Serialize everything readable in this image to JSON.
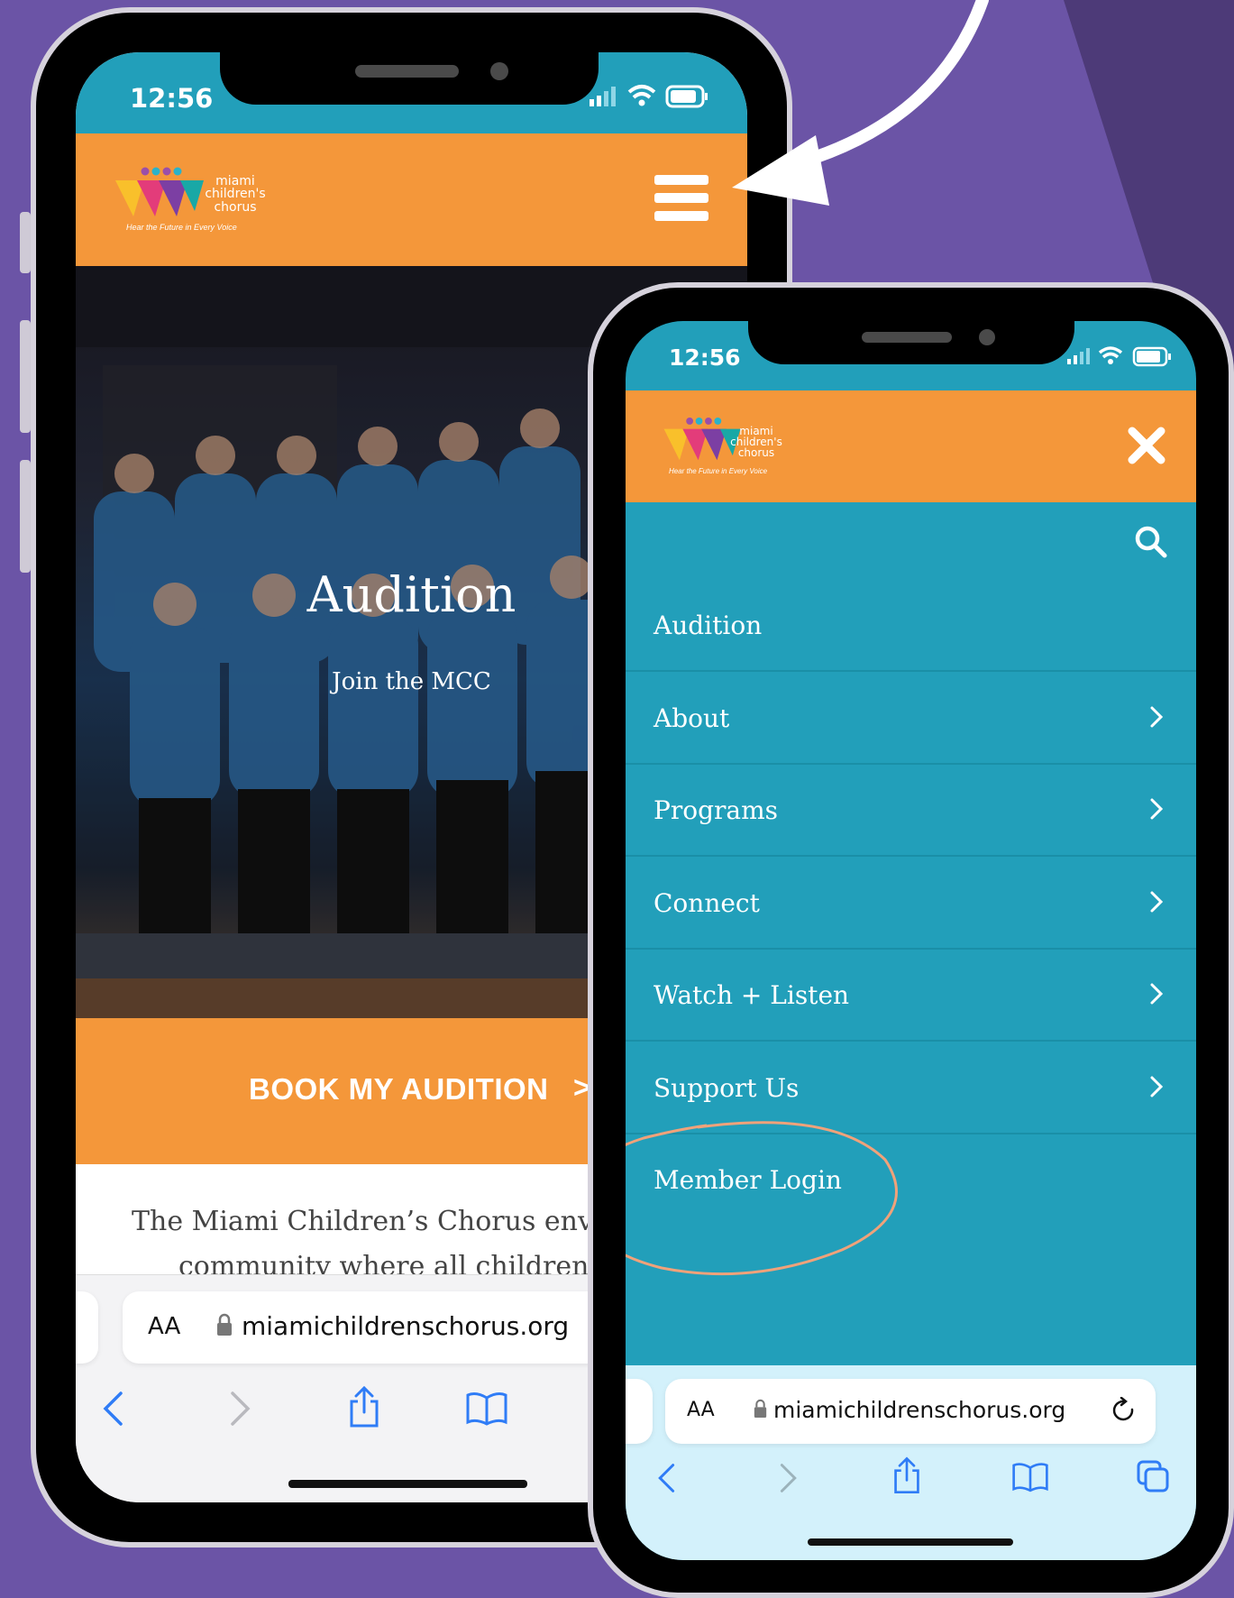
{
  "colors": {
    "background": "#6b54a6",
    "teal": "#229fba",
    "orange": "#f4973a",
    "toolbar_light": "#d3f1fb",
    "toolbar_white": "#f3f3f5",
    "accent_circle": "#f0a27a"
  },
  "logo": {
    "line1": "miami",
    "line2": "children's",
    "line3": "chorus",
    "tagline": "Hear the Future in Every Voice"
  },
  "phone_left": {
    "status_time": "12:56",
    "hero_title": "Audition",
    "hero_subtitle": "Join the MCC",
    "cta_label": "BOOK MY AUDITION",
    "cta_arrow": ">",
    "body_line1": "The Miami Children’s Chorus env",
    "body_line2": "community where all children",
    "url_aa": "AA",
    "url": "miamichildrenschorus.org",
    "toolbar_icons": [
      "back-icon",
      "forward-icon",
      "share-icon",
      "bookmarks-icon"
    ]
  },
  "phone_right": {
    "status_time": "12:56",
    "menu_items": [
      {
        "label": "Audition",
        "has_submenu": false
      },
      {
        "label": "About",
        "has_submenu": true
      },
      {
        "label": "Programs",
        "has_submenu": true
      },
      {
        "label": "Connect",
        "has_submenu": true
      },
      {
        "label": "Watch + Listen",
        "has_submenu": true
      },
      {
        "label": "Support Us",
        "has_submenu": true
      },
      {
        "label": "Member Login",
        "has_submenu": false
      }
    ],
    "highlighted_item": "Member Login",
    "url_aa": "AA",
    "url": "miamichildrenschorus.org",
    "toolbar_icons": [
      "back-icon",
      "forward-icon",
      "share-icon",
      "bookmarks-icon",
      "tabs-icon"
    ]
  }
}
